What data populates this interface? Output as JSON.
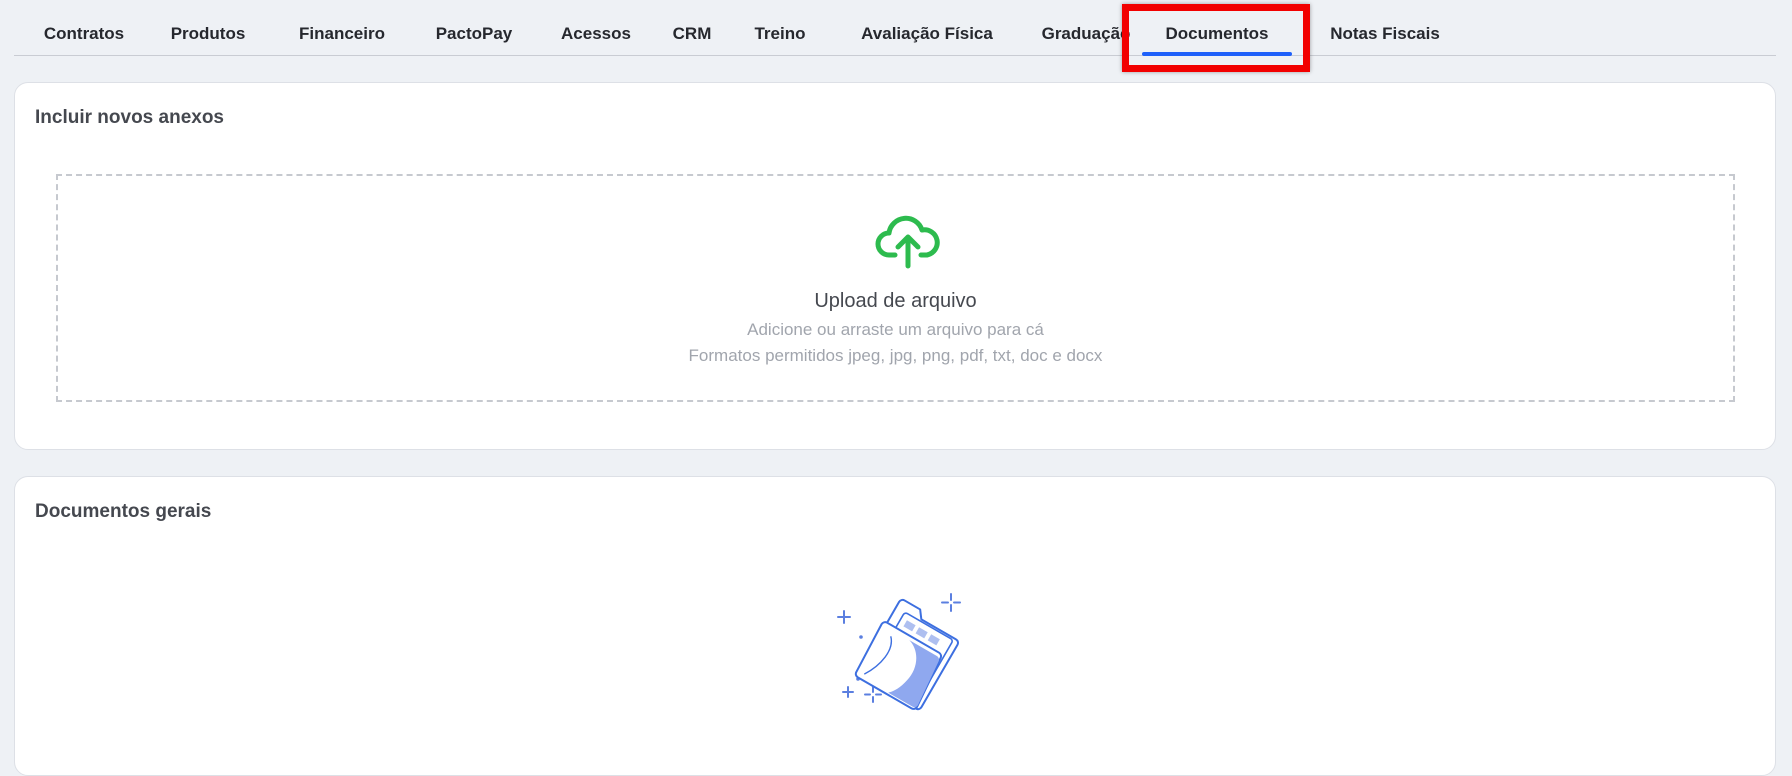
{
  "tabs": [
    {
      "label": "Contratos"
    },
    {
      "label": "Produtos"
    },
    {
      "label": "Financeiro"
    },
    {
      "label": "PactoPay"
    },
    {
      "label": "Acessos"
    },
    {
      "label": "CRM"
    },
    {
      "label": "Treino"
    },
    {
      "label": "Avaliação Física"
    },
    {
      "label": "Graduação"
    },
    {
      "label": "Documentos",
      "active": true
    },
    {
      "label": "Notas Fiscais"
    }
  ],
  "colors": {
    "accent": "#1e60fa",
    "highlight_box": "#f20000",
    "upload_icon": "#2dbb4e",
    "illustration": "#5b7fe0"
  },
  "upload_section": {
    "title": "Incluir novos anexos",
    "dropzone": {
      "icon": "cloud-upload-icon",
      "title": "Upload de arquivo",
      "subtitle": "Adicione ou arraste um arquivo para cá",
      "formats": "Formatos permitidos jpeg, jpg, png, pdf, txt, doc e docx"
    }
  },
  "documents_section": {
    "title": "Documentos gerais",
    "empty_illustration": "folder-illustration"
  }
}
